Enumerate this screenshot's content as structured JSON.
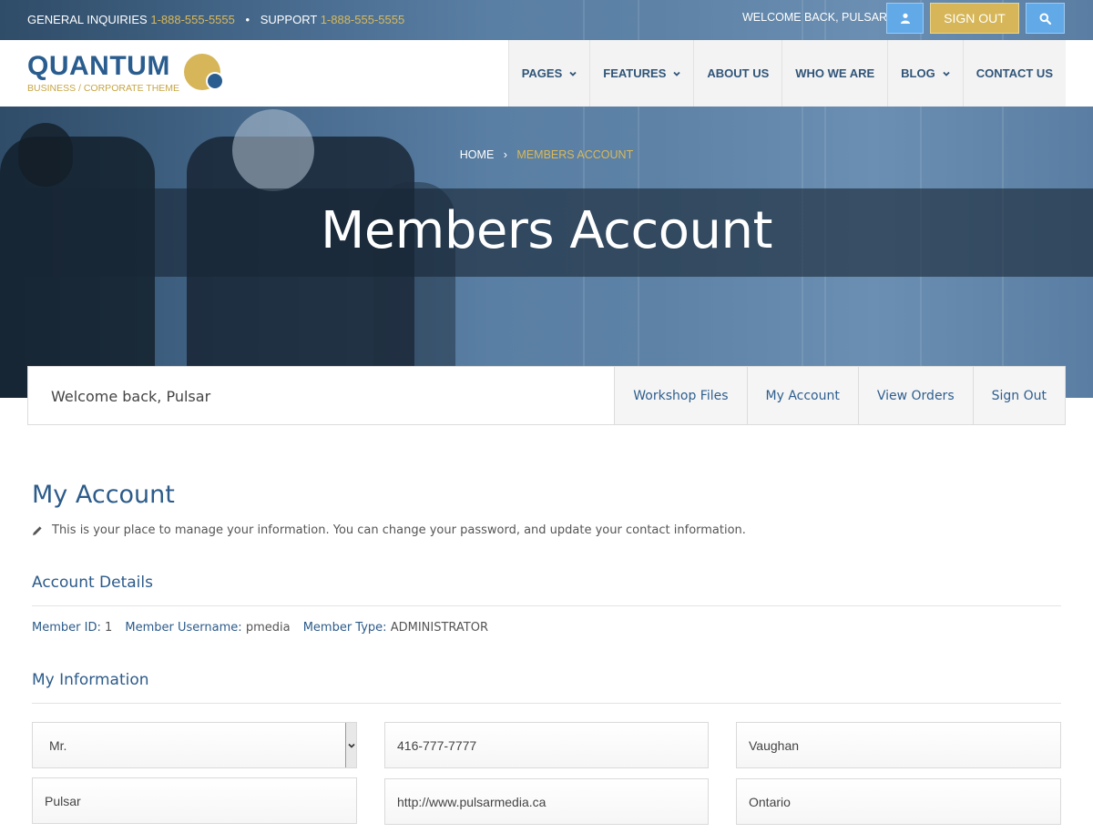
{
  "topbar": {
    "general_label": "GENERAL INQUIRIES",
    "general_phone": "1-888-555-5555",
    "separator": "•",
    "support_label": "SUPPORT",
    "support_phone": "1-888-555-5555",
    "welcome": "WELCOME BACK, PULSAR",
    "signout_label": "SIGN OUT",
    "icons": [
      "user-icon",
      "search-icon"
    ]
  },
  "logo": {
    "name": "QUANTUM",
    "tagline": "BUSINESS / CORPORATE THEME"
  },
  "nav": [
    {
      "label": "PAGES",
      "dropdown": true
    },
    {
      "label": "FEATURES",
      "dropdown": true
    },
    {
      "label": "ABOUT US",
      "dropdown": false
    },
    {
      "label": "WHO WE ARE",
      "dropdown": false
    },
    {
      "label": "BLOG",
      "dropdown": true
    },
    {
      "label": "CONTACT US",
      "dropdown": false
    }
  ],
  "breadcrumb": {
    "home": "HOME",
    "separator": "›",
    "current": "MEMBERS ACCOUNT"
  },
  "banner_title": "Members Account",
  "memberbar": {
    "welcome": "Welcome back, Pulsar",
    "links": [
      "Workshop Files",
      "My Account",
      "View Orders",
      "Sign Out"
    ]
  },
  "page": {
    "title": "My Account",
    "intro": "This is your place to manage your information. You can change your password, and update your contact information.",
    "account_details_heading": "Account Details",
    "member_id_label": "Member ID:",
    "member_id": "1",
    "username_label": "Member Username:",
    "username": "pmedia",
    "type_label": "Member Type:",
    "type": "ADMINISTRATOR",
    "my_information_heading": "My Information"
  },
  "form": {
    "salutation": "Mr.",
    "first_name": "Pulsar",
    "phone": "416-777-7777",
    "website": "http://www.pulsarmedia.ca",
    "city": "Vaughan",
    "province": "Ontario"
  },
  "colors": {
    "brand_blue": "#2a5d8f",
    "gold": "#d6b658",
    "button_blue": "#62a9e8"
  }
}
